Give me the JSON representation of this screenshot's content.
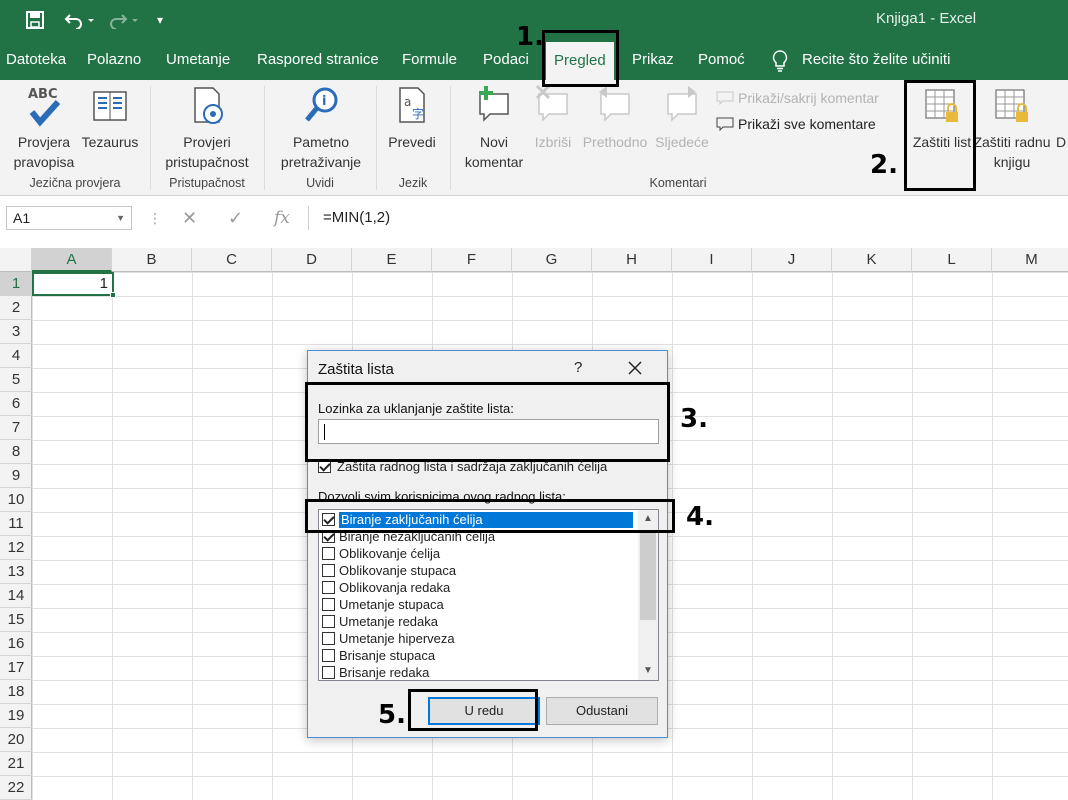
{
  "title_bar": {
    "doc_title": "Knjiga1  -  Excel",
    "save_icon": "save-icon",
    "undo_icon": "undo-icon",
    "redo_icon": "redo-icon",
    "customize_icon": "customize-qat-icon"
  },
  "tabs": [
    {
      "label": "Datoteka"
    },
    {
      "label": "Polazno"
    },
    {
      "label": "Umetanje"
    },
    {
      "label": "Raspored stranice"
    },
    {
      "label": "Formule"
    },
    {
      "label": "Podaci"
    },
    {
      "label": "Pregled",
      "active": true
    },
    {
      "label": "Prikaz"
    },
    {
      "label": "Pomoć"
    }
  ],
  "tell_me": "Recite što želite učiniti",
  "ribbon": {
    "spelling": "Provjera pravopisa",
    "thesaurus": "Tezaurus",
    "accessibility": "Provjeri pristupačnost",
    "smart_lookup": "Pametno pretraživanje",
    "translate": "Prevedi",
    "new_comment": "Novi komentar",
    "delete": "Izbriši",
    "previous": "Prethodno",
    "next": "Sljedeće",
    "show_hide_comment": "Prikaži/sakrij komentar",
    "show_all_comments": "Prikaži sve komentare",
    "protect_sheet": "Zaštiti list",
    "protect_workbook": "Zaštiti radnu knjigu",
    "cut_off": "D",
    "groups": {
      "proofing": "Jezična provjera",
      "accessibility": "Pristupačnost",
      "insights": "Uvidi",
      "language": "Jezik",
      "comments": "Komentari"
    }
  },
  "formula_bar": {
    "name_box": "A1",
    "formula": "=MIN(1,2)",
    "fx": "fx"
  },
  "grid": {
    "columns": [
      "A",
      "B",
      "C",
      "D",
      "E",
      "F",
      "G",
      "H",
      "I",
      "J",
      "K",
      "L",
      "M"
    ],
    "rows": [
      "1",
      "2",
      "3",
      "4",
      "5",
      "6",
      "7",
      "8",
      "9",
      "10",
      "11",
      "12",
      "13",
      "14",
      "15",
      "16",
      "17",
      "18",
      "19",
      "20",
      "21",
      "22"
    ],
    "a1_value": "1"
  },
  "dialog": {
    "title": "Zaštita lista",
    "help": "?",
    "password_label": "Lozinka za uklanjanje zaštite lista:",
    "password_value": "",
    "protect_label": "Zaštita radnog lista i sadržaja zaključanih ćelija",
    "protect_checked": true,
    "allow_label": "Dozvoli svim korisnicima ovog radnog lista:",
    "options": [
      {
        "label": "Biranje zaključanih ćelija",
        "checked": true,
        "selected": true
      },
      {
        "label": "Biranje nezaključanih ćelija",
        "checked": true
      },
      {
        "label": "Oblikovanje ćelija",
        "checked": false
      },
      {
        "label": "Oblikovanje stupaca",
        "checked": false
      },
      {
        "label": "Oblikovanja redaka",
        "checked": false
      },
      {
        "label": "Umetanje stupaca",
        "checked": false
      },
      {
        "label": "Umetanje redaka",
        "checked": false
      },
      {
        "label": "Umetanje hiperveza",
        "checked": false
      },
      {
        "label": "Brisanje stupaca",
        "checked": false
      },
      {
        "label": "Brisanje redaka",
        "checked": false
      }
    ],
    "ok": "U redu",
    "cancel": "Odustani"
  },
  "annotations": {
    "step1": "1.",
    "step2": "2.",
    "step3": "3.",
    "step4": "4.",
    "step5": "5."
  },
  "colors": {
    "excel_green": "#217346",
    "selection_blue": "#0078d7"
  }
}
